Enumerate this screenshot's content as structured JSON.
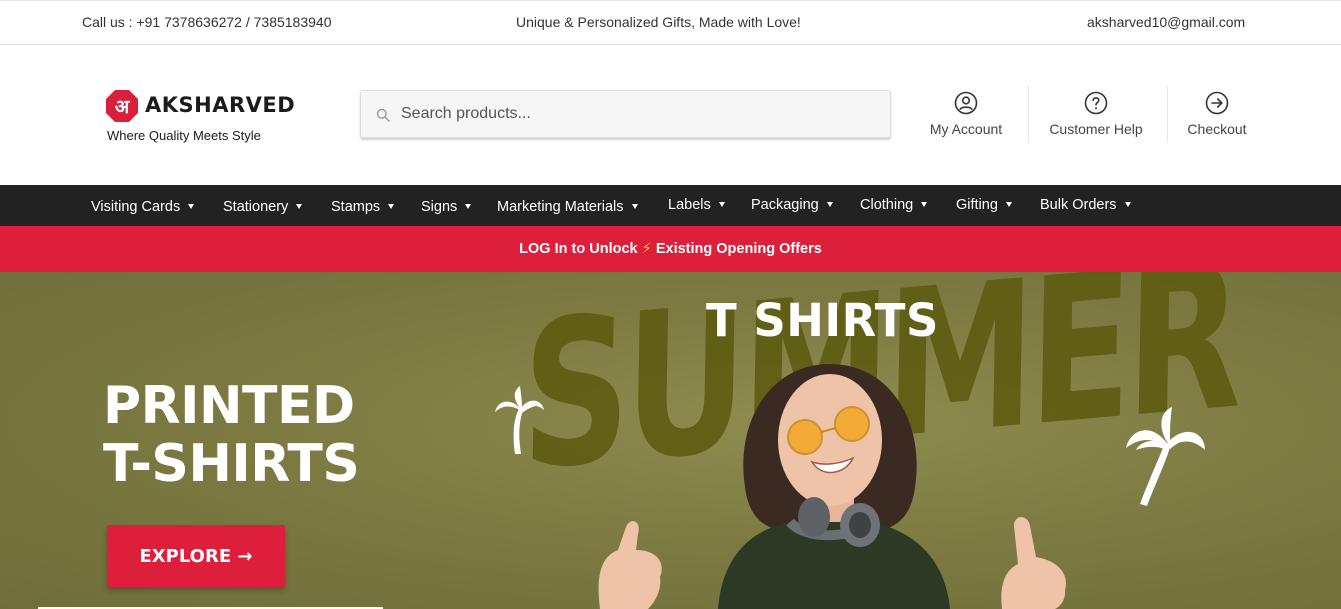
{
  "topbar": {
    "call": "Call us : +91 7378636272 / 7385183940",
    "tagline": "Unique & Personalized Gifts, Made with Love!",
    "email": "aksharved10@gmail.com"
  },
  "logo": {
    "name": "AKSHARVED",
    "tagline": "Where Quality Meets Style",
    "badge_text": "अ"
  },
  "search": {
    "placeholder": "Search products..."
  },
  "header_links": [
    {
      "label": "My Account",
      "icon": "user-circle-icon"
    },
    {
      "label": "Customer Help",
      "icon": "help-circle-icon"
    },
    {
      "label": "Checkout",
      "icon": "arrow-circle-right-icon"
    }
  ],
  "nav": [
    {
      "label": "Visiting Cards"
    },
    {
      "label": "Stationery"
    },
    {
      "label": "Stamps"
    },
    {
      "label": "Signs"
    },
    {
      "label": "Marketing Materials"
    },
    {
      "label": "Labels"
    },
    {
      "label": "Packaging"
    },
    {
      "label": "Clothing"
    },
    {
      "label": "Gifting"
    },
    {
      "label": "Bulk Orders"
    }
  ],
  "promo": {
    "left": "LOG In to Unlock",
    "bolt": "⚡",
    "right": "Existing Opening Offers"
  },
  "hero": {
    "title_line1": "PRINTED",
    "title_line2": "T-SHIRTS",
    "button": "EXPLORE →",
    "heading": "T SHIRTS",
    "art_text": "SUMMER"
  },
  "colors": {
    "accent": "#dd1f3c",
    "nav_bg": "#222222",
    "hero_bg": "#7d7b42",
    "art_text": "#5f5c12"
  }
}
